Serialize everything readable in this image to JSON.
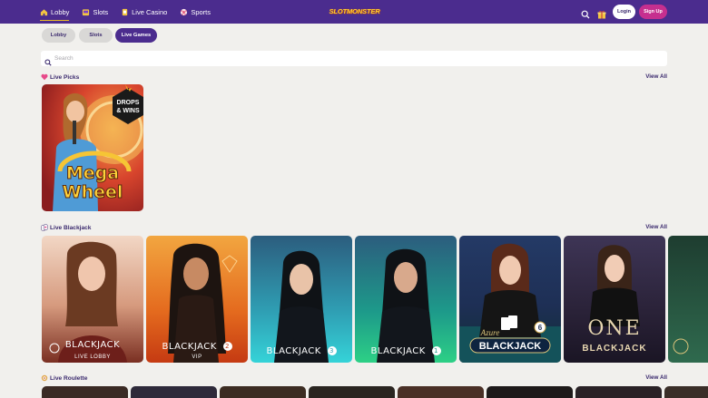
{
  "topbar": {
    "nav": [
      {
        "label": "Lobby",
        "icon": "home-icon"
      },
      {
        "label": "Slots",
        "icon": "slot-machine-icon"
      },
      {
        "label": "Live Casino",
        "icon": "live-casino-icon"
      },
      {
        "label": "Sports",
        "icon": "soccer-ball-icon"
      }
    ],
    "logo": "SLOTMONSTER",
    "login_label": "Login",
    "signup_label": "Sign Up"
  },
  "subtabs": [
    {
      "label": "Lobby"
    },
    {
      "label": "Slots"
    },
    {
      "label": "Live Games",
      "active": true
    }
  ],
  "search": {
    "placeholder": "Search"
  },
  "sections": {
    "live_picks": {
      "title": "Live Picks",
      "view_all": "View All",
      "games": [
        {
          "title": "Mega Wheel",
          "title_line1": "Mega",
          "title_line2": "Wheel",
          "badge_line1": "DROPS",
          "badge_line2": "& WINS"
        }
      ]
    },
    "live_blackjack": {
      "title": "Live Blackjack",
      "view_all": "View All",
      "games": [
        {
          "label": "BLACKJACK",
          "sub": "LIVE LOBBY"
        },
        {
          "label": "BLACKJACK",
          "number": "2",
          "sub": "VIP"
        },
        {
          "label": "BLACKJACK",
          "number": "3"
        },
        {
          "label": "BLACKJACK",
          "number": "1"
        },
        {
          "label": "BLACKJACK",
          "prefix": "Azure",
          "number": "6"
        },
        {
          "label": "BLACKJACK",
          "prefix": "ONE"
        }
      ]
    },
    "live_roulette": {
      "title": "Live Roulette",
      "view_all": "View All"
    }
  },
  "colors": {
    "topbar": "#4b2c8e",
    "accent_yellow": "#e8b92a",
    "signup": "#c62f8f",
    "background": "#f1f0ed"
  }
}
